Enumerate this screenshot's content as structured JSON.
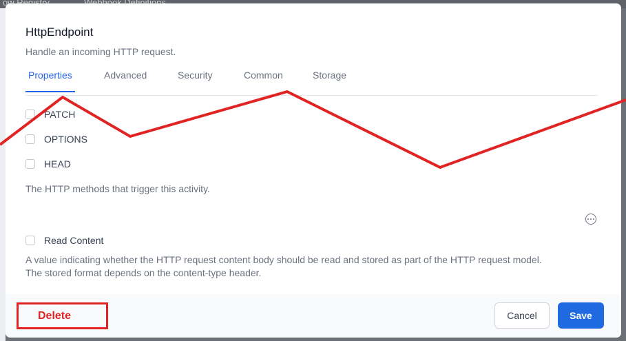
{
  "backdrop": {
    "tab_1": "ow Registry",
    "tab_2": "Webhook Definitions"
  },
  "modal": {
    "title": "HttpEndpoint",
    "subtitle": "Handle an incoming HTTP request."
  },
  "tabs": [
    {
      "label": "Properties",
      "active": true
    },
    {
      "label": "Advanced",
      "active": false
    },
    {
      "label": "Security",
      "active": false
    },
    {
      "label": "Common",
      "active": false
    },
    {
      "label": "Storage",
      "active": false
    }
  ],
  "methods": {
    "options": [
      {
        "label": "PATCH",
        "checked": false
      },
      {
        "label": "OPTIONS",
        "checked": false
      },
      {
        "label": "HEAD",
        "checked": false
      }
    ],
    "help": "The HTTP methods that trigger this activity."
  },
  "read_content": {
    "label": "Read Content",
    "checked": false,
    "help_line_1": "A value indicating whether the HTTP request content body should be read and stored as part of the HTTP request model.",
    "help_line_2": "The stored format depends on the content-type header."
  },
  "footer": {
    "delete_label": "Delete",
    "cancel_label": "Cancel",
    "save_label": "Save"
  },
  "colors": {
    "accent": "#2563eb",
    "annotation_red": "#e02424",
    "save_blue": "#1f6ae0"
  },
  "icons": {
    "more": "more-options-icon"
  }
}
